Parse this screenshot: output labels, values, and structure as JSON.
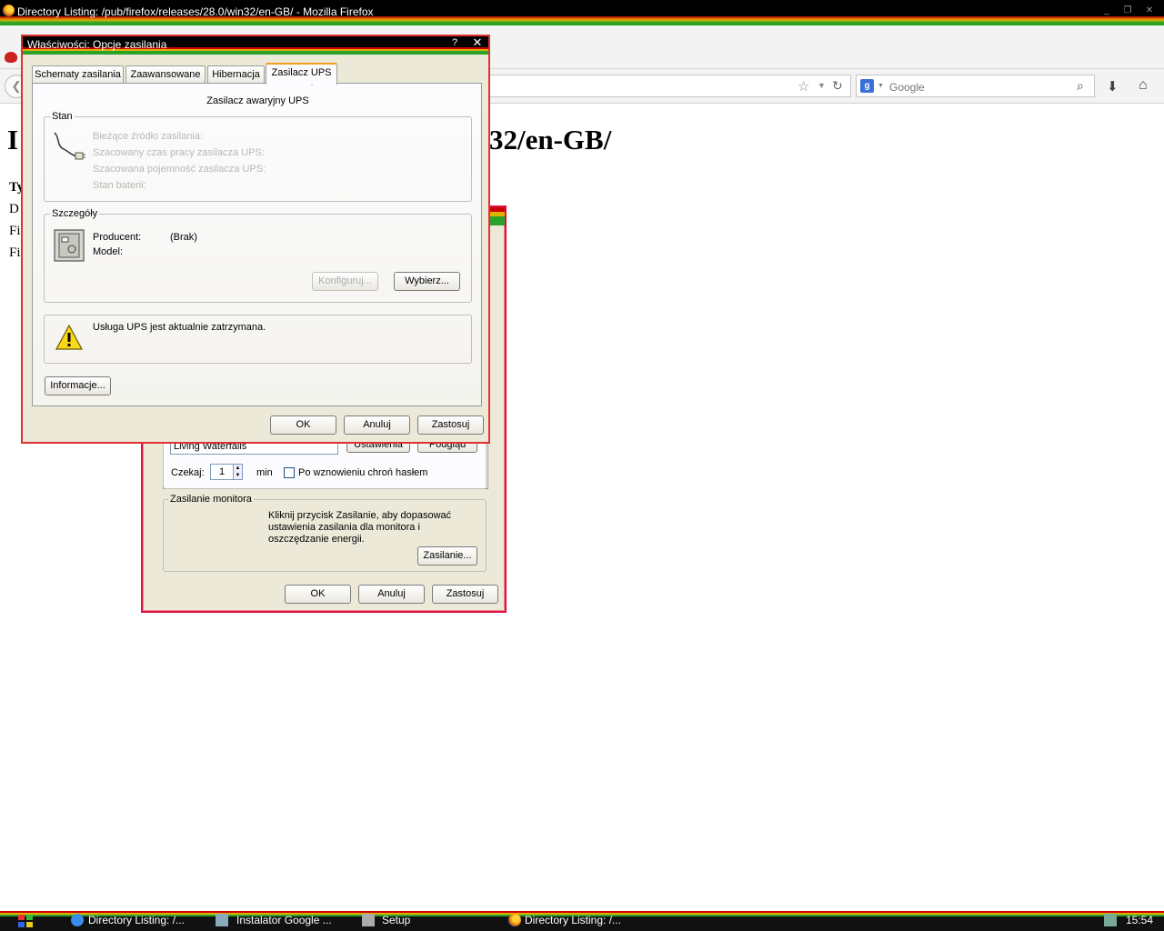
{
  "firefox": {
    "window_title": "Directory Listing: /pub/firefox/releases/28.0/win32/en-GB/ - Mozilla Firefox",
    "search_placeholder": "Google",
    "page_heading_start": "I",
    "page_heading_end": "32/en-GB/",
    "left_rows": [
      "Ty",
      "D",
      "Fi",
      "Fi"
    ]
  },
  "back_dialog": {
    "scheme_value": "Living Waterfalls",
    "settings_btn": "Ustawienia",
    "preview_btn": "Podgląd",
    "wait_label": "Czekaj:",
    "wait_value": "1",
    "wait_unit": "min",
    "password_checkbox_label": "Po wznowieniu chroń hasłem",
    "monitor_group_label": "Zasilanie monitora",
    "monitor_text": "Kliknij przycisk Zasilanie, aby dopasować ustawienia zasilania dla monitora i oszczędzanie energii.",
    "power_btn": "Zasilanie...",
    "ok_btn": "OK",
    "cancel_btn": "Anuluj",
    "apply_btn": "Zastosuj"
  },
  "front_dialog": {
    "title": "Właściwości: Opcje zasilania",
    "help": "?",
    "tabs": [
      "Schematy zasilania",
      "Zaawansowane",
      "Hibernacja",
      "Zasilacz UPS"
    ],
    "panel_title": "Zasilacz awaryjny UPS",
    "status_group_label": "Stan",
    "status_lines": [
      "Bieżące źródło zasilania:",
      "Szacowany czas pracy zasilacza UPS:",
      "Szacowana pojemność zasilacza UPS:",
      "Stan baterii:"
    ],
    "details_group_label": "Szczegóły",
    "manufacturer_label": "Producent:",
    "manufacturer_value": "(Brak)",
    "model_label": "Model:",
    "configure_btn": "Konfiguruj...",
    "select_btn": "Wybierz...",
    "service_message": "Usługa UPS jest aktualnie zatrzymana.",
    "info_btn": "Informacje...",
    "ok_btn": "OK",
    "cancel_btn": "Anuluj",
    "apply_btn": "Zastosuj"
  },
  "taskbar": {
    "items": [
      "Directory Listing: /...",
      "Instalator Google ...",
      "Setup",
      "Directory Listing: /..."
    ],
    "clock": "15:54"
  }
}
